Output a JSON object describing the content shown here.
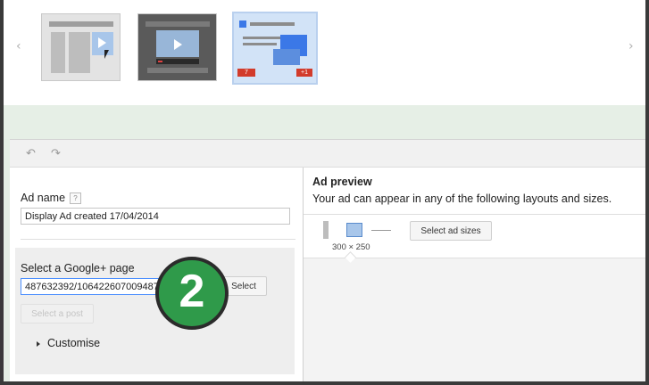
{
  "carousel": {
    "prev_icon": "chevron-left-icon",
    "next_icon": "chevron-right-icon",
    "badges": {
      "comments": "7",
      "plus": "+1"
    }
  },
  "toolbar": {
    "undo_icon": "undo-icon",
    "redo_icon": "redo-icon"
  },
  "left": {
    "ad_name_label": "Ad name",
    "help_label": "?",
    "ad_name_value": "Display Ad created 17/04/2014",
    "google_page_label": "Select a Google+ page",
    "google_page_value": "487632392/10642260700948763",
    "select_button": "Select",
    "select_post_button": "Select a post",
    "customise_label": "Customise",
    "step_badge": "2"
  },
  "right": {
    "preview_title": "Ad preview",
    "preview_subtitle": "Your ad can appear in any of the following layouts and sizes.",
    "size_label": "300 × 250",
    "select_sizes_button": "Select ad sizes"
  },
  "colors": {
    "step_badge_green": "#2f9a4a",
    "accent_blue": "#3b78e7",
    "selected_thumb_border": "#b9d0ee"
  }
}
